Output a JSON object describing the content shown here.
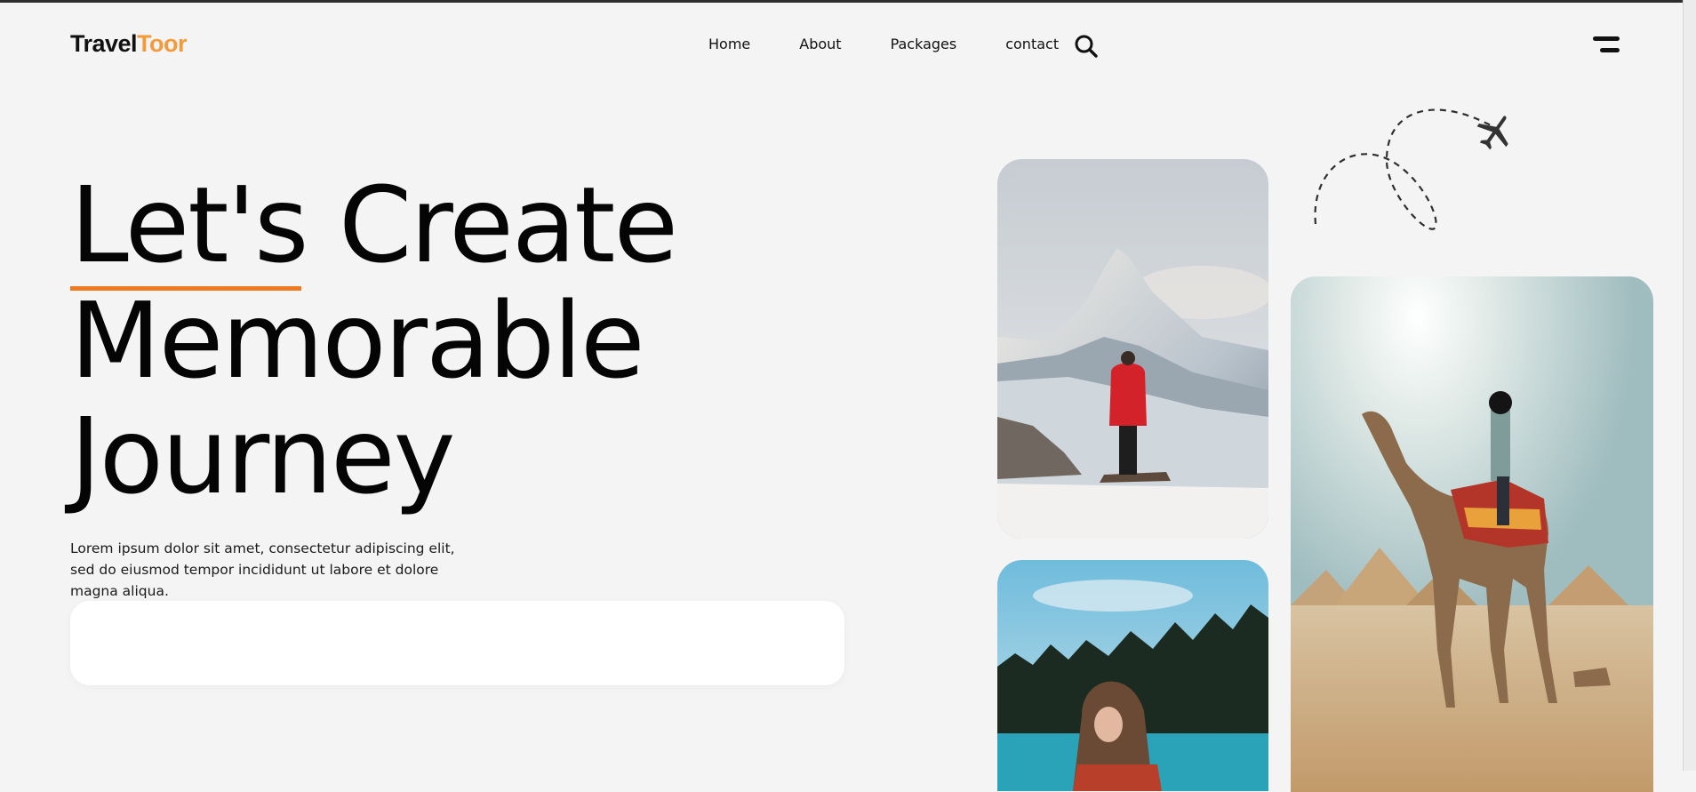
{
  "brand": {
    "part1": "Travel",
    "part2": "Toor",
    "accent_color": "#f39a3c"
  },
  "nav": {
    "items": [
      "Home",
      "About",
      "Packages",
      "contact"
    ],
    "search_icon": "search-icon"
  },
  "menu_icon": "hamburger-menu-icon",
  "hero": {
    "line1": "Let's Create",
    "line2": "Memorable",
    "line3": "Journey",
    "underline_color": "#f07a22",
    "description": "Lorem ipsum dolor sit amet, consectetur adipiscing elit, sed do eiusmod tempor incididunt ut labore et dolore magna aliqua."
  },
  "decor": {
    "plane_icon": "airplane-icon"
  },
  "gallery": [
    {
      "name": "mountain-photo"
    },
    {
      "name": "lake-photo"
    },
    {
      "name": "camel-pyramids-photo"
    }
  ]
}
